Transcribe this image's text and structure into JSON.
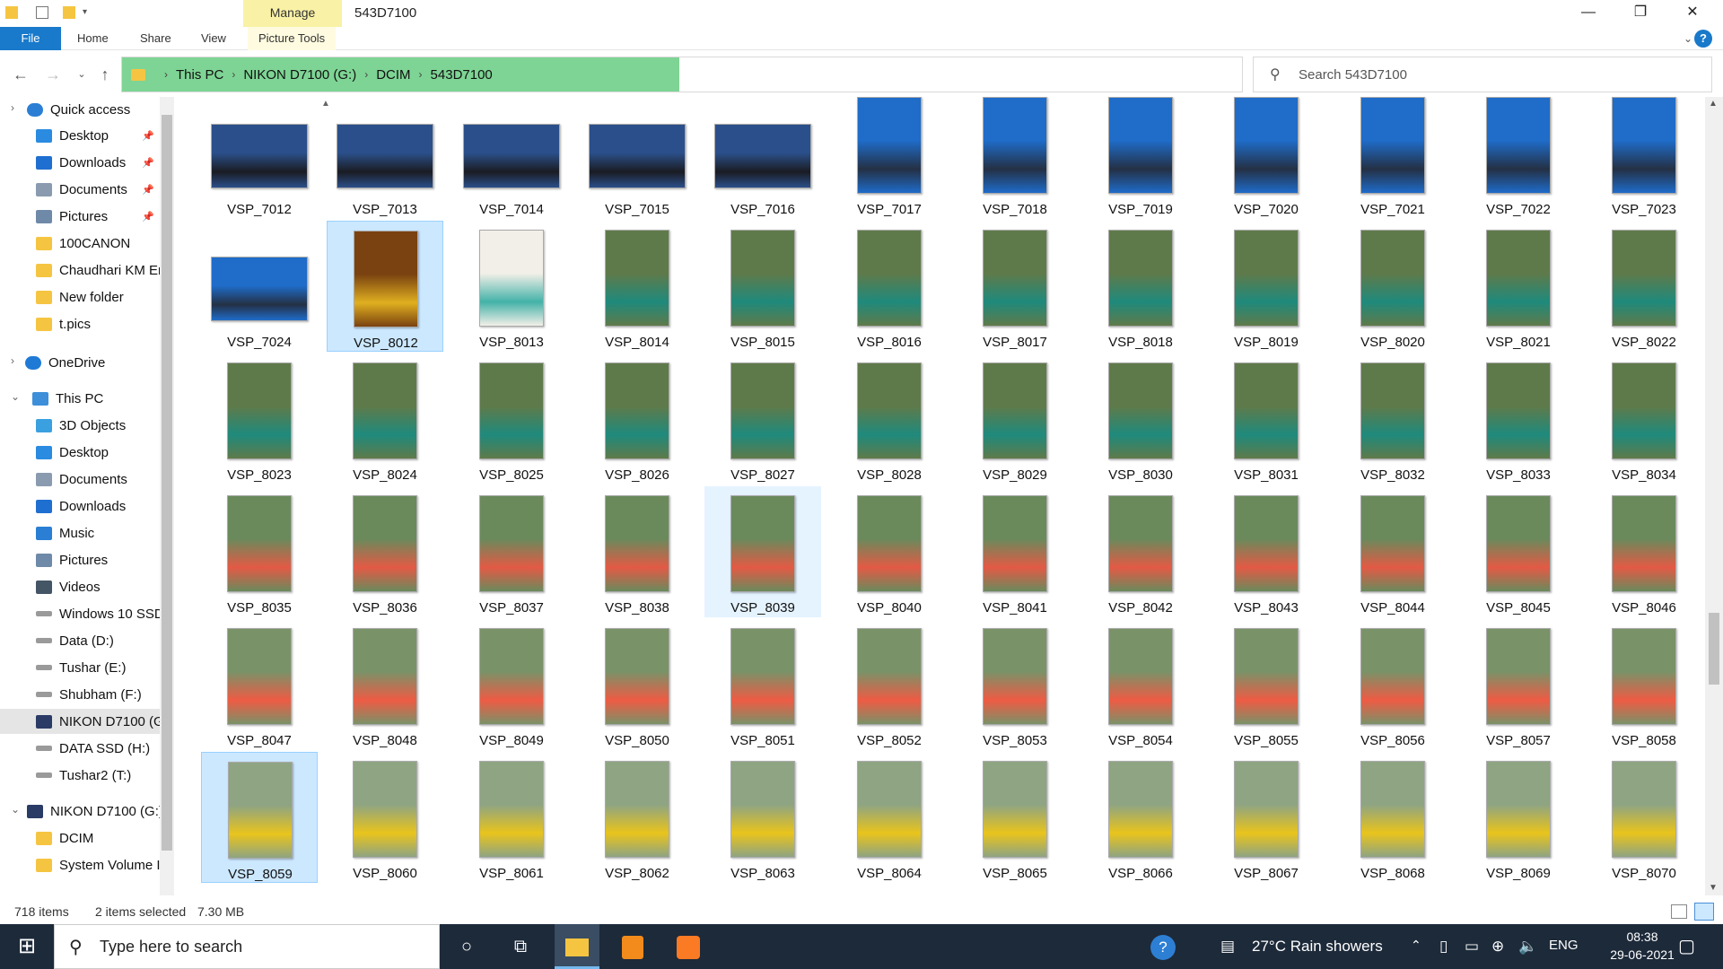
{
  "window": {
    "title": "543D7100",
    "manage_tab": "Manage",
    "minimize": "—",
    "maximize": "❐",
    "close": "✕"
  },
  "ribbon": {
    "tabs": [
      "File",
      "Home",
      "Share",
      "View",
      "Picture Tools"
    ]
  },
  "address": {
    "crumbs": [
      "This PC",
      "NIKON D7100 (G:)",
      "DCIM",
      "543D7100"
    ],
    "search_placeholder": "Search 543D7100"
  },
  "nav": {
    "items": [
      {
        "label": "Quick access",
        "icon": "star-icon"
      },
      {
        "label": "Desktop",
        "icon": "desktop-icon",
        "pinned": "📌"
      },
      {
        "label": "Downloads",
        "icon": "download-icon",
        "pinned": "📌"
      },
      {
        "label": "Documents",
        "icon": "documents-icon",
        "pinned": "📌"
      },
      {
        "label": "Pictures",
        "icon": "pictures-icon",
        "pinned": "📌"
      },
      {
        "label": "100CANON",
        "icon": "folder-icon"
      },
      {
        "label": "Chaudhari KM Er",
        "icon": "folder-icon"
      },
      {
        "label": "New folder",
        "icon": "folder-icon"
      },
      {
        "label": "t.pics",
        "icon": "folder-icon"
      },
      {
        "label": "OneDrive",
        "icon": "cloud-icon"
      },
      {
        "label": "This PC",
        "icon": "pc-icon"
      },
      {
        "label": "3D Objects",
        "icon": "cube-icon"
      },
      {
        "label": "Desktop",
        "icon": "desktop-icon"
      },
      {
        "label": "Documents",
        "icon": "documents-icon"
      },
      {
        "label": "Downloads",
        "icon": "download-icon"
      },
      {
        "label": "Music",
        "icon": "music-icon"
      },
      {
        "label": "Pictures",
        "icon": "pictures-icon"
      },
      {
        "label": "Videos",
        "icon": "videos-icon"
      },
      {
        "label": "Windows 10 SSD",
        "icon": "drive-icon"
      },
      {
        "label": "Data (D:)",
        "icon": "drive-icon"
      },
      {
        "label": "Tushar (E:)",
        "icon": "drive-icon"
      },
      {
        "label": "Shubham (F:)",
        "icon": "drive-icon"
      },
      {
        "label": "NIKON D7100 (G",
        "icon": "sd-card-icon",
        "selected": true
      },
      {
        "label": "DATA SSD (H:)",
        "icon": "drive-icon"
      },
      {
        "label": "Tushar2 (T:)",
        "icon": "drive-icon"
      },
      {
        "label": "NIKON D7100 (G:)",
        "icon": "sd-card-icon"
      },
      {
        "label": "DCIM",
        "icon": "folder-icon"
      },
      {
        "label": "System Volume I",
        "icon": "folder-icon"
      }
    ]
  },
  "files": [
    [
      "VSP_7012",
      "VSP_7013",
      "VSP_7014",
      "VSP_7015",
      "VSP_7016",
      "VSP_7017",
      "VSP_7018",
      "VSP_7019",
      "VSP_7020",
      "VSP_7021",
      "VSP_7022",
      "VSP_7023"
    ],
    [
      "VSP_7024",
      "VSP_8012",
      "VSP_8013",
      "VSP_8014",
      "VSP_8015",
      "VSP_8016",
      "VSP_8017",
      "VSP_8018",
      "VSP_8019",
      "VSP_8020",
      "VSP_8021",
      "VSP_8022"
    ],
    [
      "VSP_8023",
      "VSP_8024",
      "VSP_8025",
      "VSP_8026",
      "VSP_8027",
      "VSP_8028",
      "VSP_8029",
      "VSP_8030",
      "VSP_8031",
      "VSP_8032",
      "VSP_8033",
      "VSP_8034"
    ],
    [
      "VSP_8035",
      "VSP_8036",
      "VSP_8037",
      "VSP_8038",
      "VSP_8039",
      "VSP_8040",
      "VSP_8041",
      "VSP_8042",
      "VSP_8043",
      "VSP_8044",
      "VSP_8045",
      "VSP_8046"
    ],
    [
      "VSP_8047",
      "VSP_8048",
      "VSP_8049",
      "VSP_8050",
      "VSP_8051",
      "VSP_8052",
      "VSP_8053",
      "VSP_8054",
      "VSP_8055",
      "VSP_8056",
      "VSP_8057",
      "VSP_8058"
    ],
    [
      "VSP_8059",
      "VSP_8060",
      "VSP_8061",
      "VSP_8062",
      "VSP_8063",
      "VSP_8064",
      "VSP_8065",
      "VSP_8066",
      "VSP_8067",
      "VSP_8068",
      "VSP_8069",
      "VSP_8070"
    ]
  ],
  "selected_files": [
    "VSP_8012",
    "VSP_8059"
  ],
  "hover_files": [
    "VSP_8039"
  ],
  "status": {
    "count": "718 items",
    "selected": "2 items selected",
    "size": "7.30 MB"
  },
  "taskbar": {
    "search_placeholder": "Type here to search",
    "weather": "27°C  Rain showers",
    "lang": "ENG",
    "time": "08:38",
    "date": "29-06-2021"
  },
  "colors": {
    "accent": "#1979ca",
    "address_fill": "#7ed494",
    "selection": "#cce8ff",
    "taskbar": "#1d2a3a"
  }
}
